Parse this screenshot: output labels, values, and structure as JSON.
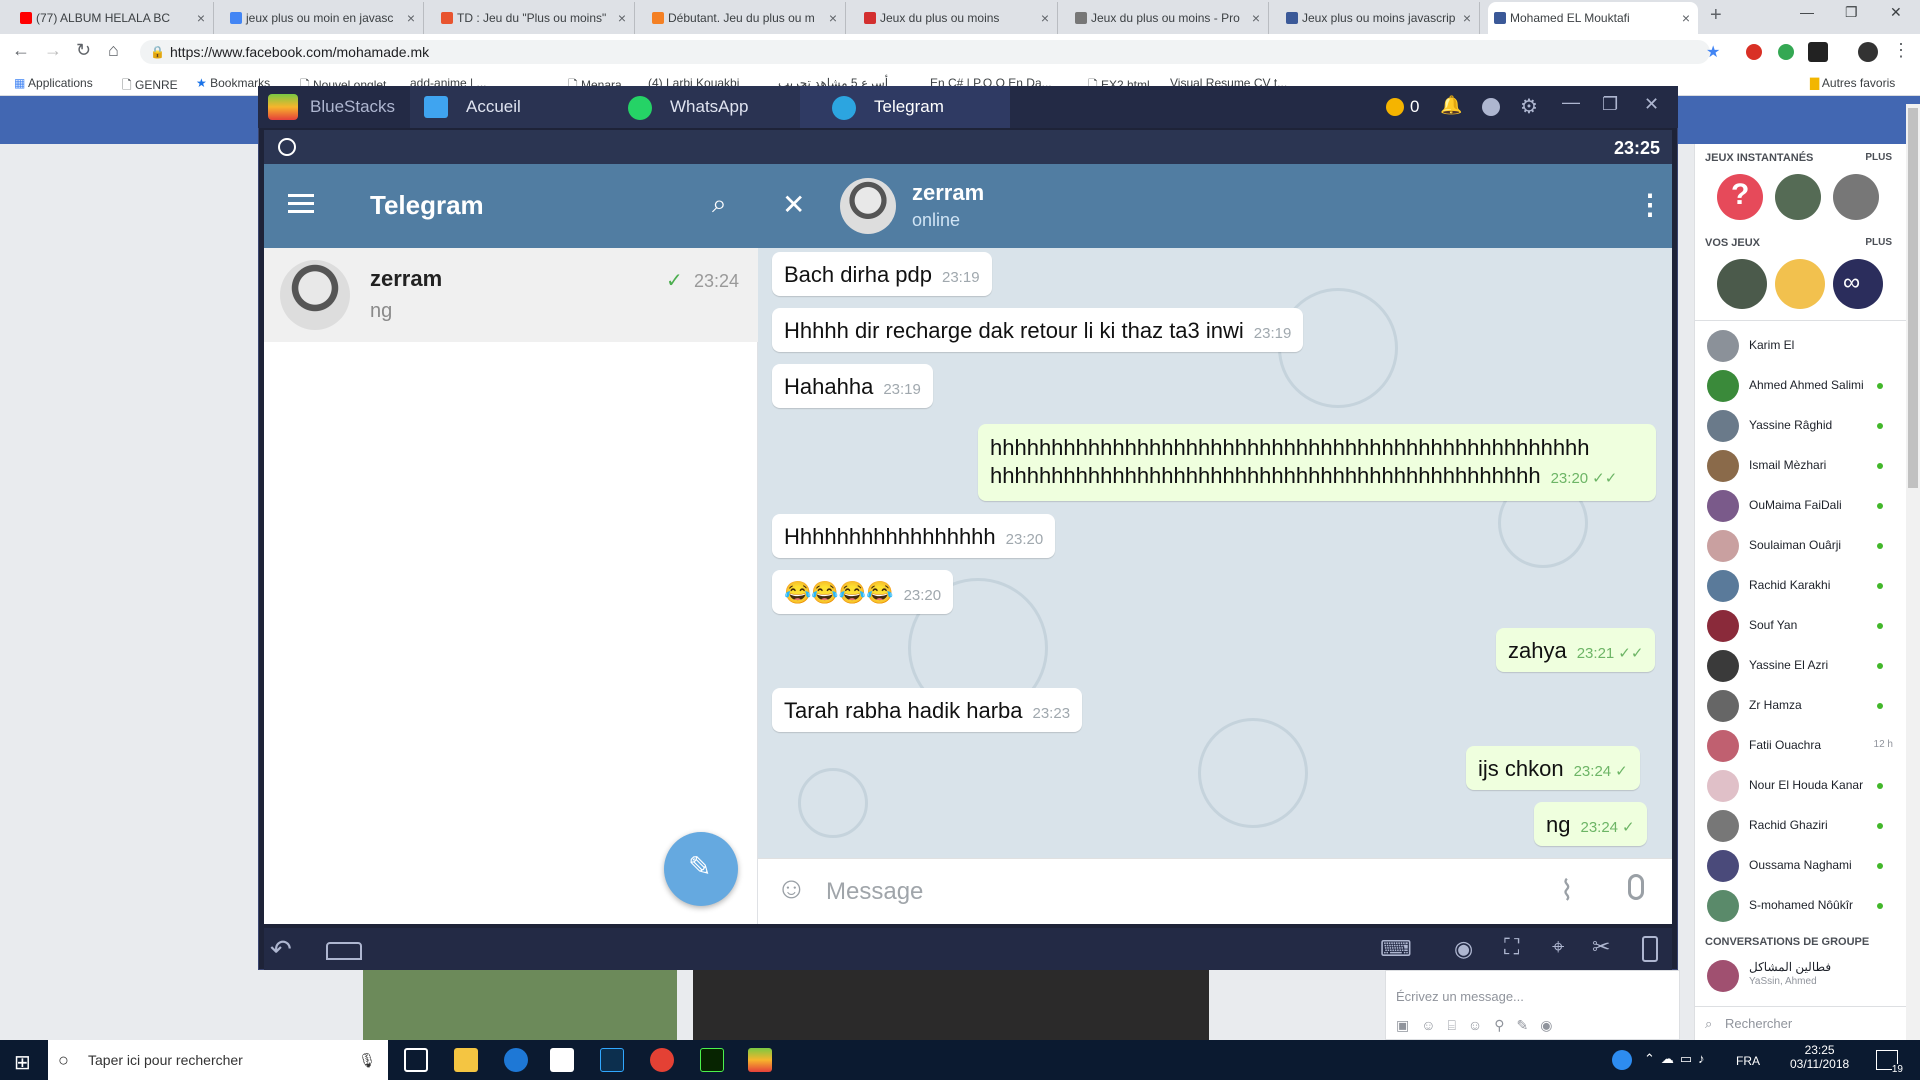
{
  "browser": {
    "tabs": [
      {
        "title": "(77) ALBUM HELALA BC",
        "color": "#ff0000"
      },
      {
        "title": "jeux plus ou moin en javasc",
        "color": "#4285f4"
      },
      {
        "title": "TD : Jeu du \"Plus ou moins\"",
        "color": "#e8542f"
      },
      {
        "title": "Débutant. Jeu du plus ou m",
        "color": "#f48024"
      },
      {
        "title": "Jeux du plus ou moins",
        "color": "#d32f2f"
      },
      {
        "title": "Jeux du plus ou moins - Pro",
        "color": "#777777"
      },
      {
        "title": "Jeux plus ou moins javascrip",
        "color": "#3b5998"
      },
      {
        "title": "Mohamed EL Mouktafi",
        "color": "#3b5998"
      }
    ],
    "url": "https://www.facebook.com/mohamade.mk",
    "bookmarks": [
      "Applications",
      "GENRE",
      "Bookmarks",
      "Nouvel onglet",
      "add-anime | ...",
      "Menara",
      "(4) Larbi Kouakbi",
      "أسرع 5 مشاهد تجريب",
      "En C# | P.O.O En Da...",
      "EX2.html",
      "Visual Resume CV t...",
      "Autres favoris"
    ]
  },
  "facebook": {
    "instant_games_label": "JEUX INSTANTANÉS",
    "your_games_label": "VOS JEUX",
    "more_label": "PLUS",
    "contacts": [
      {
        "name": "Karim El",
        "online": false,
        "time": ""
      },
      {
        "name": "Ahmed Ahmed Salimi",
        "online": true,
        "time": ""
      },
      {
        "name": "Yassine Râghid",
        "online": true,
        "time": ""
      },
      {
        "name": "Ismail Mèzhari",
        "online": true,
        "time": ""
      },
      {
        "name": "OuMaima FaiDali",
        "online": true,
        "time": ""
      },
      {
        "name": "Soulaiman Ouârji",
        "online": true,
        "time": ""
      },
      {
        "name": "Rachid Karakhi",
        "online": true,
        "time": ""
      },
      {
        "name": "Souf Yan",
        "online": true,
        "time": ""
      },
      {
        "name": "Yassine El Azri",
        "online": true,
        "time": ""
      },
      {
        "name": "Zr Hamza",
        "online": true,
        "time": ""
      },
      {
        "name": "Fatii Ouachra",
        "online": false,
        "time": "12 h"
      },
      {
        "name": "Nour El Houda Kanar",
        "online": true,
        "time": ""
      },
      {
        "name": "Rachid Ghaziri",
        "online": true,
        "time": ""
      },
      {
        "name": "Oussama Naghami",
        "online": true,
        "time": ""
      },
      {
        "name": "S-mohamed Nôûkîr",
        "online": true,
        "time": ""
      }
    ],
    "group_label": "CONVERSATIONS DE GROUPE",
    "group": {
      "name": "فطالين المشاكل",
      "members": "YaSsin, Ahmed"
    },
    "search_placeholder": "Rechercher",
    "chat_placeholder": "Écrivez un message..."
  },
  "bluestacks": {
    "app_name": "BlueStacks",
    "tabs": [
      "Accueil",
      "WhatsApp",
      "Telegram"
    ],
    "coins": "0",
    "clock": "23:25"
  },
  "telegram": {
    "title": "Telegram",
    "chat_list": [
      {
        "name": "zerram",
        "preview": "ng",
        "time": "23:24"
      }
    ],
    "contact": {
      "name": "zerram",
      "status": "online"
    },
    "messages": [
      {
        "text": "Bach dirha pdp",
        "time": "23:19",
        "out": false
      },
      {
        "text": "Hhhhh dir recharge dak retour li ki thaz ta3 inwi",
        "time": "23:19",
        "out": false
      },
      {
        "text": "Hahahha",
        "time": "23:19",
        "out": false
      },
      {
        "text": "hhhhhhhhhhhhhhhhhhhhhhhhhhhhhhhhhhhhhhhhhhhhhhhhh",
        "text2": "hhhhhhhhhhhhhhhhhhhhhhhhhhhhhhhhhhhhhhhhhhhhh",
        "time": "23:20",
        "out": true
      },
      {
        "text": "Hhhhhhhhhhhhhhhhh",
        "time": "23:20",
        "out": false
      },
      {
        "text": "😂😂😂😂",
        "time": "23:20",
        "out": false
      },
      {
        "text": "zahya",
        "time": "23:21",
        "out": true
      },
      {
        "text": "Tarah rabha hadik harba",
        "time": "23:23",
        "out": false
      },
      {
        "text": "ijs chkon",
        "time": "23:24",
        "out": true
      },
      {
        "text": "ng",
        "time": "23:24",
        "out": true
      }
    ],
    "input_placeholder": "Message"
  },
  "taskbar": {
    "search_placeholder": "Taper ici pour rechercher",
    "lang": "FRA",
    "time": "23:25",
    "date": "03/11/2018",
    "notif_count": "19"
  }
}
